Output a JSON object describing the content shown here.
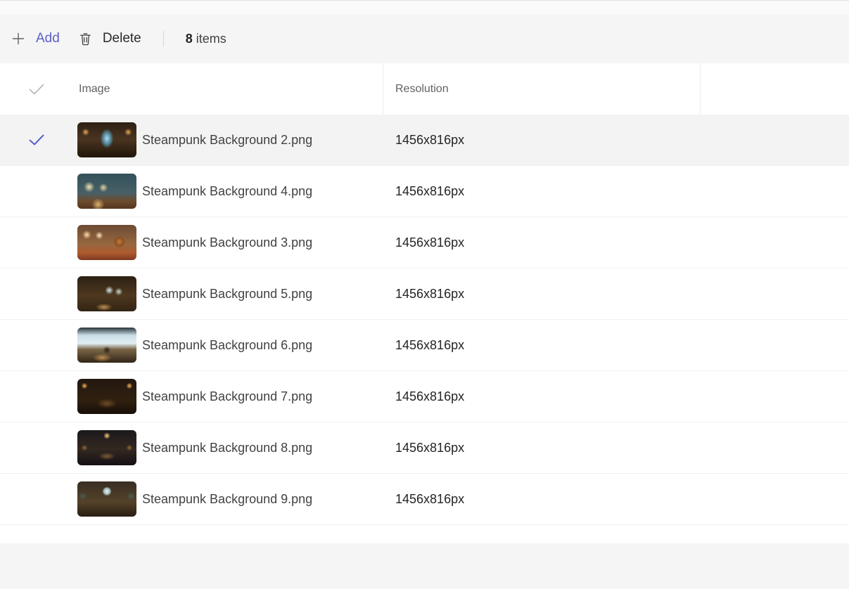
{
  "toolbar": {
    "add_label": "Add",
    "delete_label": "Delete",
    "items_count": "8",
    "items_label": "items"
  },
  "table": {
    "columns": {
      "image": "Image",
      "resolution": "Resolution"
    },
    "rows": [
      {
        "name": "Steampunk Background 2.png",
        "resolution": "1456x816px",
        "selected": true,
        "thumb_style": "background: radial-gradient(ellipse 13px 19px at 50% 46%, #aadcee 0%, #4f7f93 45%, rgba(40,28,16,0) 72%), radial-gradient(circle 7px at 14% 28%, rgba(255,184,90,0.9), rgba(255,184,90,0) 75%), radial-gradient(circle 7px at 86% 28%, rgba(255,184,90,0.9), rgba(255,184,90,0) 75%), linear-gradient(180deg, #2c2014 0%, #4a3420 48%, #201609 100%);"
      },
      {
        "name": "Steampunk Background 4.png",
        "resolution": "1456x816px",
        "selected": false,
        "thumb_style": "background: radial-gradient(circle 11px at 20% 38%, #f5e2ae 0%, rgba(245,226,174,0) 70%), radial-gradient(circle 9px at 44% 40%, #e3d09e 0%, rgba(227,208,158,0) 70%), radial-gradient(circle 12px at 35% 88%, rgba(244,196,120,0.85), rgba(244,196,120,0) 75%), linear-gradient(180deg, #33505a 0%, #486067 55%, #6d4b2c 78%, #55371f 100%);"
      },
      {
        "name": "Steampunk Background 3.png",
        "resolution": "1456x816px",
        "selected": false,
        "thumb_style": "background: radial-gradient(circle 11px at 71% 48%, #c87a35 0%, #8a4e24 55%, rgba(138,78,36,0) 75%), radial-gradient(circle 9px at 16% 28%, #ffdca6 0%, rgba(255,220,166,0) 70%), radial-gradient(circle 8px at 37% 30%, #ffe9c4 0%, rgba(255,233,196,0) 70%), linear-gradient(180deg, #6b4a33 0%, #97683f 55%, #b05a2e 80%, #7c3a20 100%);"
      },
      {
        "name": "Steampunk Background 5.png",
        "resolution": "1456x816px",
        "selected": false,
        "thumb_style": "background: radial-gradient(circle 9px at 54% 40%, #d9ecf2 0%, rgba(217,236,242,0) 68%), radial-gradient(circle 8px at 70% 44%, #c4dcc9 0%, rgba(196,220,201,0) 70%), radial-gradient(ellipse 16px 7px at 45% 88%, rgba(226,170,100,0.8), rgba(226,170,100,0) 75%), linear-gradient(180deg, #2c2013 0%, #4e3820 55%, #332413 100%);"
      },
      {
        "name": "Steampunk Background 6.png",
        "resolution": "1456x816px",
        "selected": false,
        "thumb_style": "background: radial-gradient(circle 8px at 50% 64%, rgba(30,22,14,0.9), rgba(30,22,14,0) 70%), radial-gradient(ellipse 18px 8px at 42% 86%, rgba(235,175,95,0.7), rgba(235,175,95,0) 75%), linear-gradient(180deg, #27323a 0%, #c8dde6 22%, #e2eff4 45%, #7a6647 62%, #312517 100%);"
      },
      {
        "name": "Steampunk Background 7.png",
        "resolution": "1456x816px",
        "selected": false,
        "thumb_style": "background: radial-gradient(circle 6px at 12% 20%, #ffb857 0%, rgba(255,184,87,0) 75%), radial-gradient(circle 6px at 88% 20%, #ffb857 0%, rgba(255,184,87,0) 75%), radial-gradient(ellipse 19px 9px at 50% 70%, #6f4d28 0%, rgba(111,77,40,0) 75%), linear-gradient(180deg, #221710 0%, #30200f 60%, #170f08 100%);"
      },
      {
        "name": "Steampunk Background 8.png",
        "resolution": "1456x816px",
        "selected": false,
        "thumb_style": "background: radial-gradient(circle 7px at 50% 16%, #ffd27d 0%, rgba(255,210,125,0) 70%), radial-gradient(ellipse 16px 7px at 50% 74%, #7d5c34 0%, rgba(125,92,52,0) 75%), radial-gradient(circle 6px at 12% 50%, rgba(214,150,70,0.6), rgba(214,150,70,0) 75%), radial-gradient(circle 6px at 88% 50%, rgba(214,150,70,0.6), rgba(214,150,70,0) 75%), linear-gradient(180deg, #1c191c 0%, #322820 55%, #151015 100%);"
      },
      {
        "name": "Steampunk Background 9.png",
        "resolution": "1456x816px",
        "selected": false,
        "thumb_style": "background: radial-gradient(circle 9px at 50% 28%, #ecf4f4 0%, #9cb6b4 50%, rgba(156,182,180,0) 72%), radial-gradient(circle 8px at 9% 42%, rgba(74,96,88,0.9), rgba(74,96,88,0) 75%), radial-gradient(circle 8px at 91% 42%, rgba(74,96,88,0.9), rgba(74,96,88,0) 75%), linear-gradient(180deg, #372e22 0%, #55422a 58%, #281d12 100%);"
      }
    ]
  },
  "colors": {
    "accent": "#5b5fc7",
    "toolbar_bg": "#f5f5f5",
    "selected_row_bg": "#f3f3f3",
    "header_text": "#616161"
  }
}
